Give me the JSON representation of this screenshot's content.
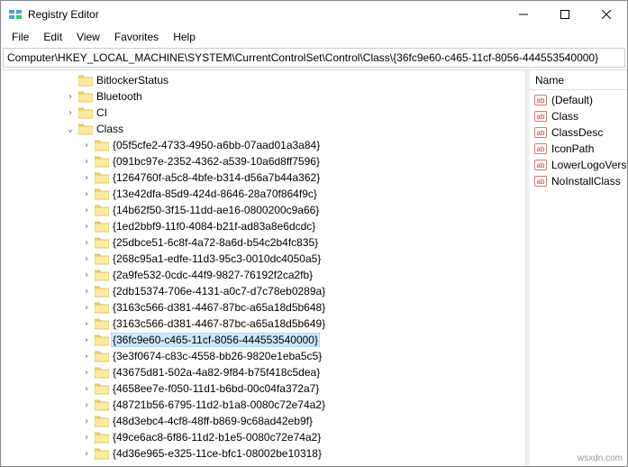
{
  "window": {
    "title": "Registry Editor"
  },
  "menu": {
    "file": "File",
    "edit": "Edit",
    "view": "View",
    "favorites": "Favorites",
    "help": "Help"
  },
  "address": "Computer\\HKEY_LOCAL_MACHINE\\SYSTEM\\CurrentControlSet\\Control\\Class\\{36fc9e60-c465-11cf-8056-444553540000}",
  "tree": {
    "indent_base": 70,
    "indent_step": 18,
    "items": [
      {
        "label": "BitlockerStatus",
        "depth": 0,
        "expander": "none",
        "selected": false
      },
      {
        "label": "Bluetooth",
        "depth": 0,
        "expander": "collapsed",
        "selected": false
      },
      {
        "label": "CI",
        "depth": 0,
        "expander": "collapsed",
        "selected": false
      },
      {
        "label": "Class",
        "depth": 0,
        "expander": "expanded",
        "selected": false
      },
      {
        "label": "{05f5cfe2-4733-4950-a6bb-07aad01a3a84}",
        "depth": 1,
        "expander": "collapsed",
        "selected": false
      },
      {
        "label": "{091bc97e-2352-4362-a539-10a6d8ff7596}",
        "depth": 1,
        "expander": "collapsed",
        "selected": false
      },
      {
        "label": "{1264760f-a5c8-4bfe-b314-d56a7b44a362}",
        "depth": 1,
        "expander": "collapsed",
        "selected": false
      },
      {
        "label": "{13e42dfa-85d9-424d-8646-28a70f864f9c}",
        "depth": 1,
        "expander": "collapsed",
        "selected": false
      },
      {
        "label": "{14b62f50-3f15-11dd-ae16-0800200c9a66}",
        "depth": 1,
        "expander": "collapsed",
        "selected": false
      },
      {
        "label": "{1ed2bbf9-11f0-4084-b21f-ad83a8e6dcdc}",
        "depth": 1,
        "expander": "collapsed",
        "selected": false
      },
      {
        "label": "{25dbce51-6c8f-4a72-8a6d-b54c2b4fc835}",
        "depth": 1,
        "expander": "collapsed",
        "selected": false
      },
      {
        "label": "{268c95a1-edfe-11d3-95c3-0010dc4050a5}",
        "depth": 1,
        "expander": "collapsed",
        "selected": false
      },
      {
        "label": "{2a9fe532-0cdc-44f9-9827-76192f2ca2fb}",
        "depth": 1,
        "expander": "collapsed",
        "selected": false
      },
      {
        "label": "{2db15374-706e-4131-a0c7-d7c78eb0289a}",
        "depth": 1,
        "expander": "collapsed",
        "selected": false
      },
      {
        "label": "{3163c566-d381-4467-87bc-a65a18d5b648}",
        "depth": 1,
        "expander": "collapsed",
        "selected": false
      },
      {
        "label": "{3163c566-d381-4467-87bc-a65a18d5b649}",
        "depth": 1,
        "expander": "collapsed",
        "selected": false
      },
      {
        "label": "{36fc9e60-c465-11cf-8056-444553540000}",
        "depth": 1,
        "expander": "collapsed",
        "selected": true
      },
      {
        "label": "{3e3f0674-c83c-4558-bb26-9820e1eba5c5}",
        "depth": 1,
        "expander": "collapsed",
        "selected": false
      },
      {
        "label": "{43675d81-502a-4a82-9f84-b75f418c5dea}",
        "depth": 1,
        "expander": "collapsed",
        "selected": false
      },
      {
        "label": "{4658ee7e-f050-11d1-b6bd-00c04fa372a7}",
        "depth": 1,
        "expander": "collapsed",
        "selected": false
      },
      {
        "label": "{48721b56-6795-11d2-b1a8-0080c72e74a2}",
        "depth": 1,
        "expander": "collapsed",
        "selected": false
      },
      {
        "label": "{48d3ebc4-4cf8-48ff-b869-9c68ad42eb9f}",
        "depth": 1,
        "expander": "collapsed",
        "selected": false
      },
      {
        "label": "{49ce6ac8-6f86-11d2-b1e5-0080c72e74a2}",
        "depth": 1,
        "expander": "collapsed",
        "selected": false
      },
      {
        "label": "{4d36e965-e325-11ce-bfc1-08002be10318}",
        "depth": 1,
        "expander": "collapsed",
        "selected": false
      }
    ]
  },
  "list": {
    "header": "Name",
    "items": [
      {
        "label": "(Default)",
        "type": "string"
      },
      {
        "label": "Class",
        "type": "string"
      },
      {
        "label": "ClassDesc",
        "type": "string"
      },
      {
        "label": "IconPath",
        "type": "string"
      },
      {
        "label": "LowerLogoVersi",
        "type": "string"
      },
      {
        "label": "NoInstallClass",
        "type": "string"
      }
    ]
  },
  "footer": "wsxdn.com"
}
